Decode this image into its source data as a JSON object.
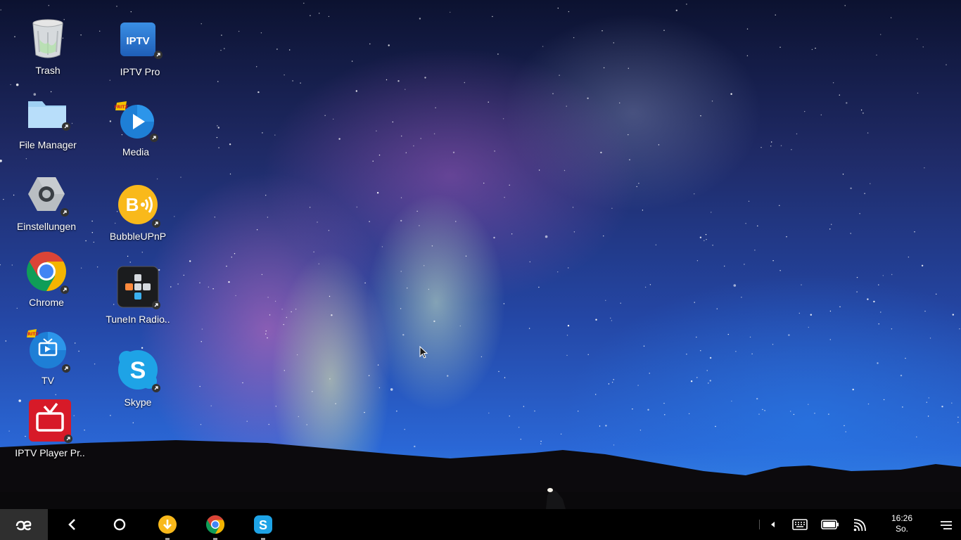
{
  "desktop": {
    "icons": [
      {
        "id": "trash",
        "label": "Trash",
        "icon": "trash-icon"
      },
      {
        "id": "file-manager",
        "label": "File Manager",
        "icon": "folder-icon"
      },
      {
        "id": "einstellungen",
        "label": "Einstellungen",
        "icon": "settings-hex-icon"
      },
      {
        "id": "chrome",
        "label": "Chrome",
        "icon": "chrome-icon"
      },
      {
        "id": "tv",
        "label": "TV",
        "icon": "fritz-tv-icon"
      },
      {
        "id": "iptv-player",
        "label": "IPTV Player Pr..",
        "icon": "iptv-player-icon"
      },
      {
        "id": "iptv-pro",
        "label": "IPTV Pro",
        "icon": "iptv-pro-icon",
        "icon_text": "IPTV"
      },
      {
        "id": "media",
        "label": "Media",
        "icon": "fritz-media-icon"
      },
      {
        "id": "bubbleupnp",
        "label": "BubbleUPnP",
        "icon": "bubbleupnp-icon"
      },
      {
        "id": "tunein",
        "label": "TuneIn Radio..",
        "icon": "tunein-icon"
      },
      {
        "id": "skype",
        "label": "Skype",
        "icon": "skype-icon",
        "icon_text": "S"
      }
    ]
  },
  "taskbar": {
    "start_icon": "jide-logo-icon",
    "nav": [
      "back-icon",
      "home-icon"
    ],
    "running_apps": [
      "download-app-icon",
      "chrome-icon",
      "skype-icon"
    ],
    "tray": [
      "tray-expand-icon",
      "keyboard-icon",
      "battery-icon",
      "cast-icon",
      "notifications-icon"
    ],
    "clock": {
      "time": "16:26",
      "day": "So."
    }
  },
  "colors": {
    "taskbar_bg": "#000000",
    "start_bg": "#2f2f2f",
    "skype_blue": "#1ea3e6",
    "chrome_red": "#db4437",
    "chrome_yellow": "#f4b400",
    "chrome_green": "#0f9d58",
    "chrome_blue": "#4285f4",
    "bubble_yellow": "#f9b91b",
    "iptv_red": "#d71a28"
  }
}
